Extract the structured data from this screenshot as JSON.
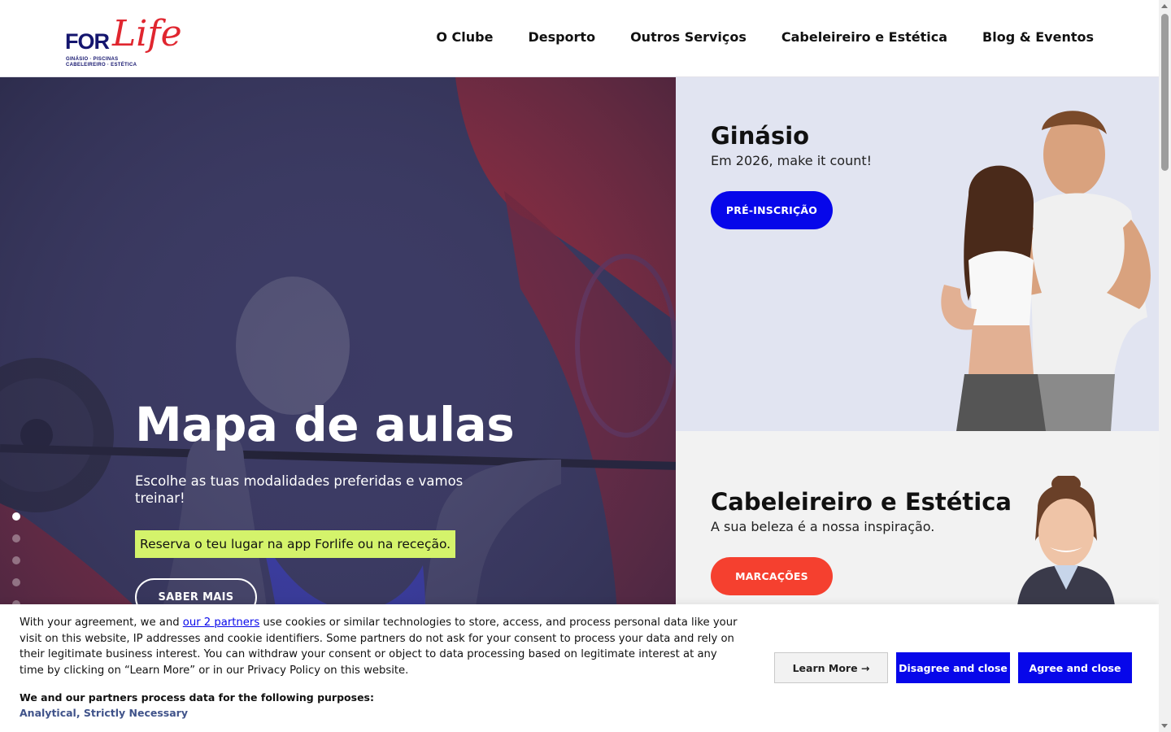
{
  "header": {
    "logo": {
      "word": "FOR",
      "script": "Life",
      "tagline_1": "GINÁSIO · PISCINAS",
      "tagline_2": "CABELEIREIRO · ESTÉTICA"
    },
    "nav": [
      {
        "label": "O Clube"
      },
      {
        "label": "Desporto"
      },
      {
        "label": "Outros Serviços"
      },
      {
        "label": "Cabeleireiro e Estética"
      },
      {
        "label": "Blog & Eventos"
      }
    ]
  },
  "hero": {
    "title": "Mapa de aulas",
    "subtitle": "Escolhe as tuas modalidades preferidas e vamos treinar!",
    "highlight": "Reserva o teu lugar na app Forlife ou na receção.",
    "button": "SABER MAIS",
    "slides_count": 7,
    "active_slide": 1
  },
  "gym": {
    "title": "Ginásio",
    "subtitle": "Em 2026, make it count!",
    "button": "PRÉ-INSCRIÇÃO"
  },
  "beauty": {
    "title": "Cabeleireiro e Estética",
    "subtitle": "A sua beleza é a nossa inspiração.",
    "button": "MARCAÇÕES"
  },
  "cookie": {
    "text_before_link": "With your agreement, we and ",
    "link": "our 2 partners",
    "text_after_link": " use cookies or similar technologies to store, access, and process personal data like your visit on this website, IP addresses and cookie identifiers. Some partners do not ask for your consent to process your data and rely on their legitimate business interest. You can withdraw your consent or object to data processing based on legitimate interest at any time by clicking on “Learn More” or in our Privacy Policy on this website.",
    "purposes_heading": "We and our partners process data for the following purposes:",
    "purposes": "Analytical, Strictly Necessary",
    "learn_more": "Learn More →",
    "disagree": "Disagree and close",
    "agree": "Agree and close"
  },
  "colors": {
    "brand_navy": "#14156e",
    "brand_red": "#e0262f",
    "primary_blue": "#0707ea",
    "coral": "#f5402f",
    "highlight_lime": "#d4f36b",
    "gym_bg": "#e1e4f1"
  }
}
